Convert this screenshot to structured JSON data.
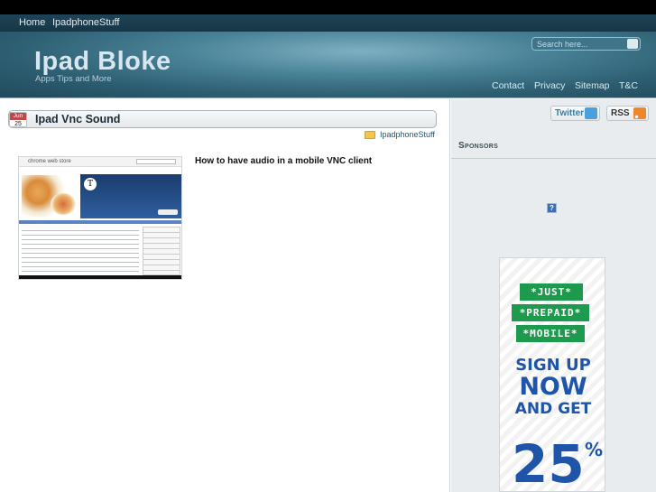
{
  "nav": {
    "items": [
      "Home",
      "IpadphoneStuff"
    ]
  },
  "header": {
    "logo": "Ipad Bloke",
    "tagline": "Apps Tips and More",
    "search_placeholder": "Search here...",
    "links": [
      "Contact",
      "Privacy",
      "Sitemap",
      "T&C"
    ]
  },
  "post": {
    "date_month": "Jun",
    "date_day": "25",
    "title": "Ipad Vnc Sound",
    "category": "IpadphoneStuff",
    "heading": "How to have audio in a mobile VNC client"
  },
  "thumbnail": {
    "store_name": "chrome web store",
    "app_icon_letter": "T"
  },
  "sidebar": {
    "twitter_label": "Twitter",
    "rss_label": "RSS",
    "sponsors_title": "Sponsors",
    "help_icon_label": "?"
  },
  "ad": {
    "tags": [
      "*JUST*",
      "*PREPAID*",
      "*MOBILE*"
    ],
    "line1": "SIGN UP",
    "line2": "NOW",
    "line3": "AND GET",
    "percent": "25",
    "percent_sign": "%"
  },
  "colors": {
    "header_accent": "#4a8398",
    "ad_green": "#1e9a4e",
    "ad_blue": "#1f55a8",
    "rss_orange": "#f0862a",
    "twitter_blue": "#4aa0dc"
  }
}
